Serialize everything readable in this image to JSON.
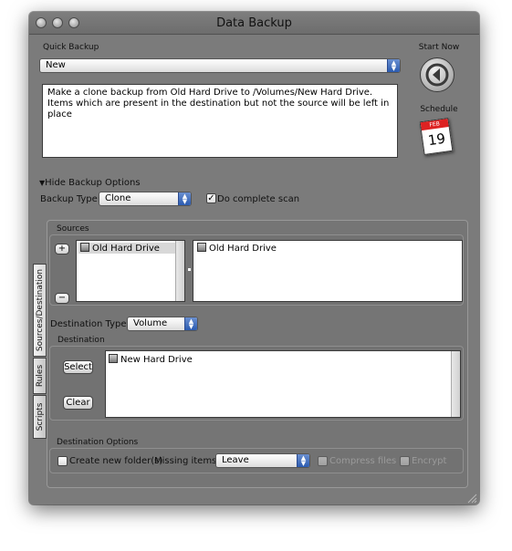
{
  "window": {
    "title": "Data Backup"
  },
  "quick_backup": {
    "label": "Quick Backup",
    "selected": "New",
    "description_line1": "Make a clone backup from Old Hard Drive to /Volumes/New Hard Drive.",
    "description_line2": "Items which are present in the destination but not the source will be left in place"
  },
  "side": {
    "start_now": "Start Now",
    "schedule": "Schedule",
    "cal_month": "FEB",
    "cal_day": "19"
  },
  "options": {
    "toggle": "Hide Backup Options",
    "backup_type_label": "Backup Type:",
    "backup_type_value": "Clone",
    "complete_scan_label": "Do complete scan",
    "complete_scan_checked": true
  },
  "tabs": [
    "Sources/Destination",
    "Rules",
    "Scripts"
  ],
  "sources": {
    "title": "Sources",
    "add_button": "+",
    "remove_button": "−",
    "list_item": "Old Hard Drive",
    "detail_item": "Old Hard Drive"
  },
  "destination_type": {
    "label": "Destination Type:",
    "value": "Volume"
  },
  "destination": {
    "title": "Destination",
    "select_button": "Select",
    "clear_button": "Clear",
    "item": "New Hard Drive"
  },
  "destination_options": {
    "title": "Destination Options",
    "create_folders_label": "Create new folder(s)",
    "missing_items_label": "Missing items:",
    "missing_items_value": "Leave",
    "compress_label": "Compress files",
    "encrypt_label": "Encrypt"
  },
  "colors": {
    "window_bg": "#7b7b7b",
    "accent": "#2b5bb0"
  },
  "icons": [
    "start-now-icon",
    "calendar-icon",
    "disclosure-triangle-icon",
    "drive-icon",
    "resize-grip-icon"
  ]
}
